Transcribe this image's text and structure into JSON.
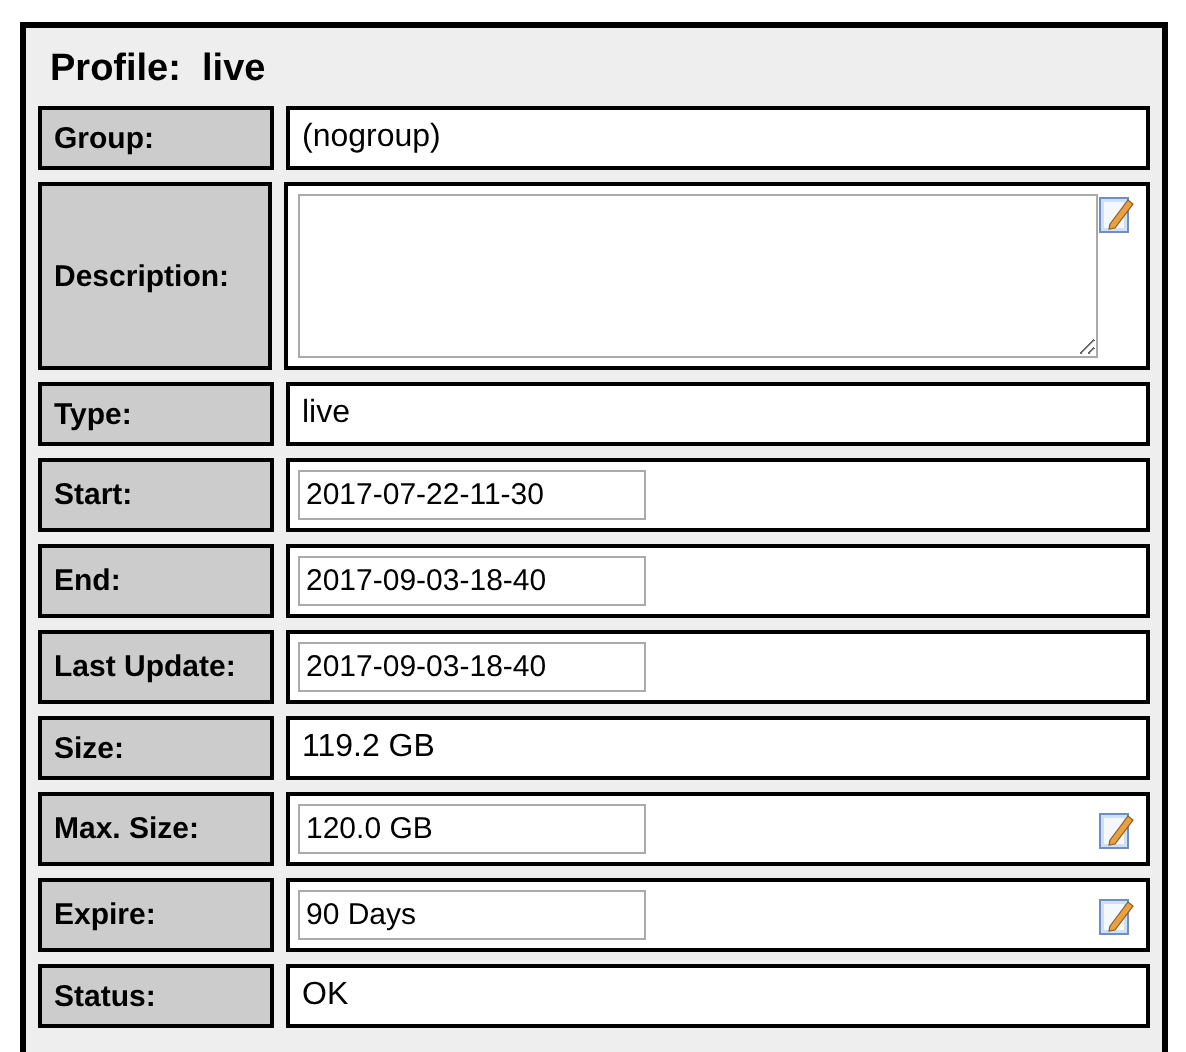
{
  "title": "Profile:  live",
  "rows": [
    {
      "label": "Group:",
      "kind": "text",
      "value": "(nogroup)",
      "editable": false
    },
    {
      "label": "Description:",
      "kind": "textarea",
      "value": "",
      "editable": true
    },
    {
      "label": "Type:",
      "kind": "text",
      "value": "live",
      "editable": false
    },
    {
      "label": "Start:",
      "kind": "input",
      "value": "2017-07-22-11-30",
      "editable": false
    },
    {
      "label": "End:",
      "kind": "input",
      "value": "2017-09-03-18-40",
      "editable": false
    },
    {
      "label": "Last Update:",
      "kind": "input",
      "value": "2017-09-03-18-40",
      "editable": false
    },
    {
      "label": "Size:",
      "kind": "text",
      "value": "119.2 GB",
      "editable": false
    },
    {
      "label": "Max. Size:",
      "kind": "input",
      "value": "120.0 GB",
      "editable": true
    },
    {
      "label": "Expire:",
      "kind": "input",
      "value": "90 Days",
      "editable": true
    },
    {
      "label": "Status:",
      "kind": "text",
      "value": "OK",
      "editable": false
    }
  ]
}
